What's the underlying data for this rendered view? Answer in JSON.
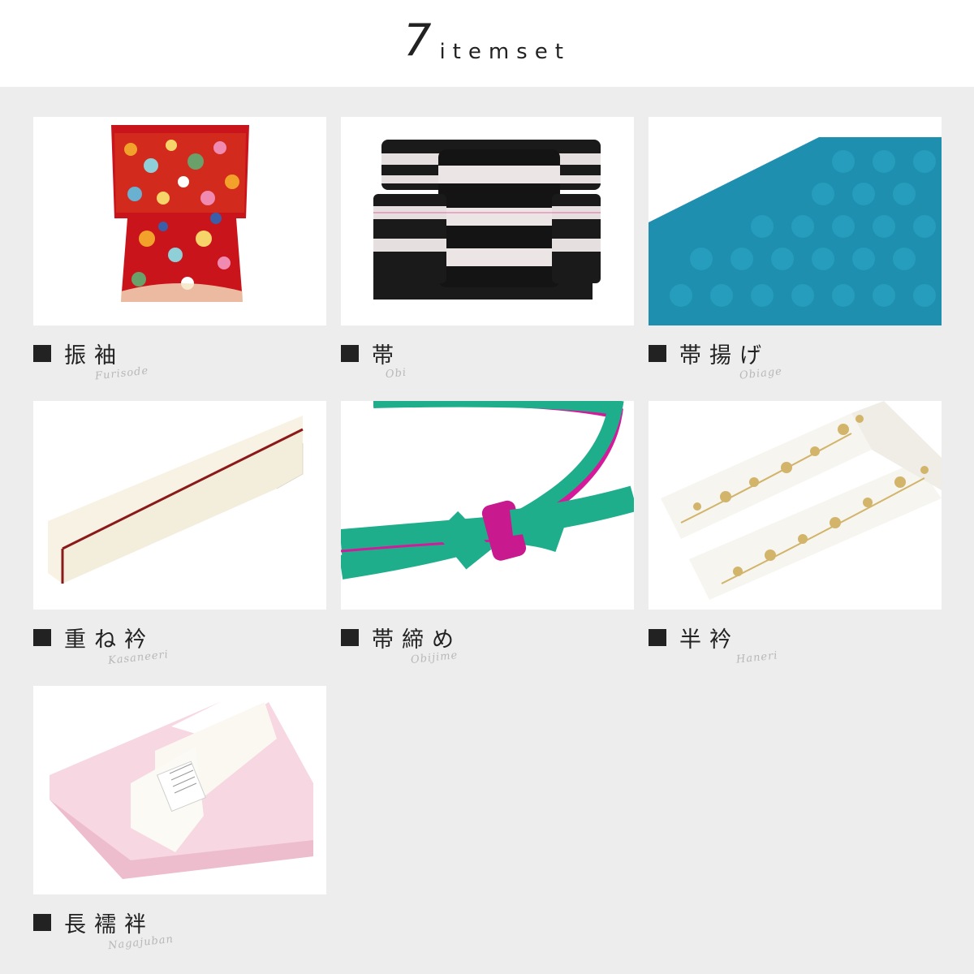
{
  "header": {
    "number": "7",
    "word": "itemset"
  },
  "items": [
    {
      "jp": "振袖",
      "romaji": "Furisode",
      "image": "furisode-image"
    },
    {
      "jp": "帯",
      "romaji": "Obi",
      "image": "obi-image"
    },
    {
      "jp": "帯揚げ",
      "romaji": "Obiage",
      "image": "obiage-image"
    },
    {
      "jp": "重ね衿",
      "romaji": "Kasaneeri",
      "image": "kasaneeri-image"
    },
    {
      "jp": "帯締め",
      "romaji": "Obijime",
      "image": "obijime-image"
    },
    {
      "jp": "半衿",
      "romaji": "Haneri",
      "image": "haneri-image"
    },
    {
      "jp": "長襦袢",
      "romaji": "Nagajuban",
      "image": "nagajuban-image"
    }
  ]
}
